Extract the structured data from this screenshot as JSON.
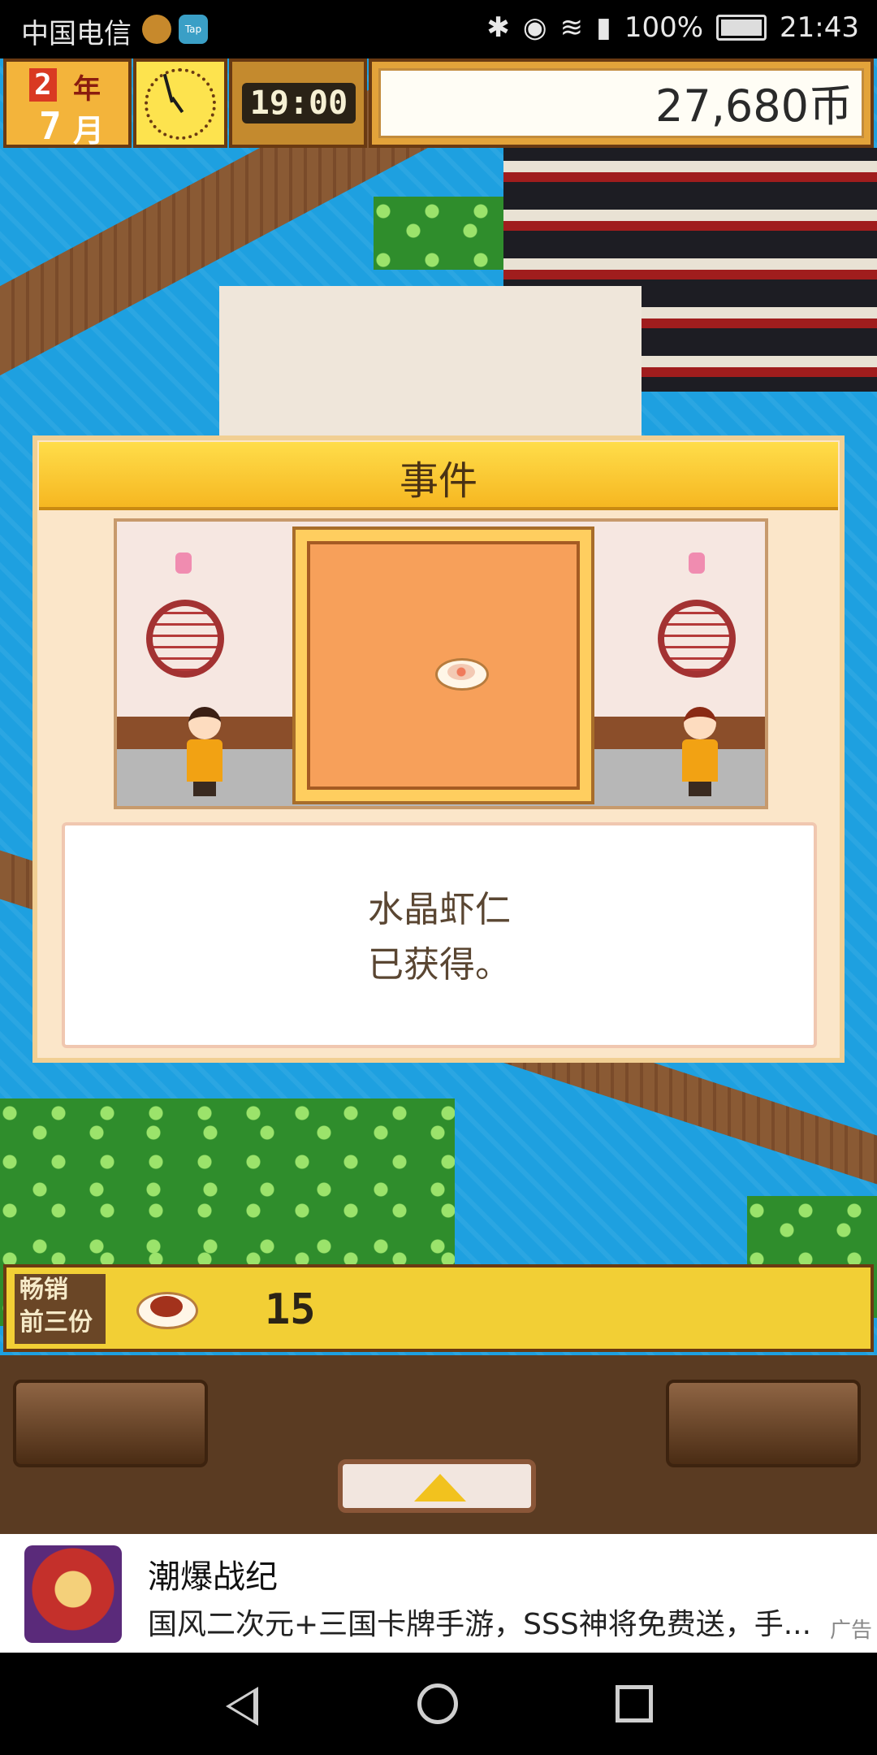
{
  "status_bar": {
    "carrier": "中国电信",
    "app_badge": "Tap",
    "battery": "100%",
    "time": "21:43"
  },
  "hud": {
    "year_num": "2",
    "year_label": "年",
    "month_num": "7",
    "month_label": "月",
    "time": "19:00",
    "coins": "27,680币"
  },
  "event": {
    "title": "事件",
    "message_line1": "水晶虾仁",
    "message_line2": "已获得。"
  },
  "bestseller": {
    "label_line1": "畅销",
    "label_line2": "前三份",
    "count": "15"
  },
  "ad": {
    "app_name": "潮爆战纪",
    "description": "国风二次元+三国卡牌手游，SSS神将免费送，手...",
    "tag": "广告"
  },
  "colors": {
    "water": "#1ea0e0",
    "hud_gold": "#f3b43b",
    "dialog_bg": "#fbe6c9",
    "title_yellow": "#ffdd4a"
  }
}
